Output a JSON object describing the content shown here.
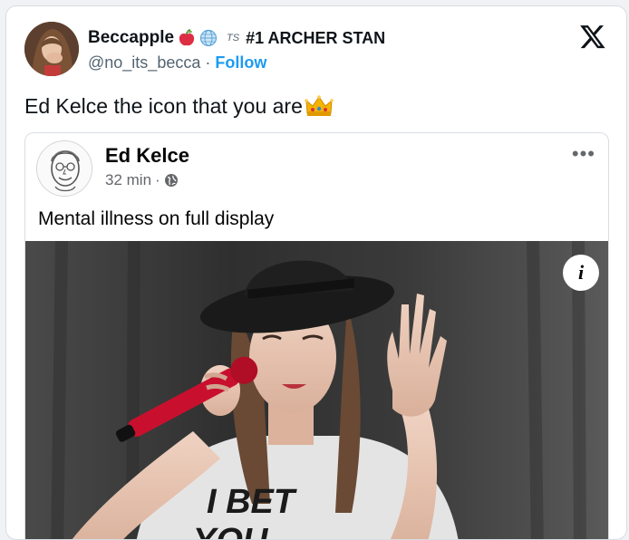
{
  "author": {
    "display_name": "Beccapple",
    "name_suffix": "#1 ARCHER STAN",
    "ts_badge": "TS",
    "handle": "@no_its_becca",
    "separator": "·",
    "follow_label": "Follow"
  },
  "tweet": {
    "text": "Ed Kelce the icon that you are"
  },
  "embedded_post": {
    "name": "Ed Kelce",
    "time": "32 min",
    "separator": "·",
    "more_label": "•••",
    "text": "Mental illness on full display",
    "info_label": "i",
    "shirt_text_line1": "I BET",
    "shirt_text_line2": "YOU"
  },
  "icons": {
    "x_logo": "x-logo-icon",
    "apple": "apple-emoji-icon",
    "globe": "globe-emoji-icon",
    "crown": "crown-emoji-icon",
    "audience": "globe-icon",
    "more": "more-options-icon",
    "info": "info-icon"
  },
  "colors": {
    "link": "#1d9bf0",
    "text_primary": "#0f1419",
    "text_secondary": "#536471"
  }
}
